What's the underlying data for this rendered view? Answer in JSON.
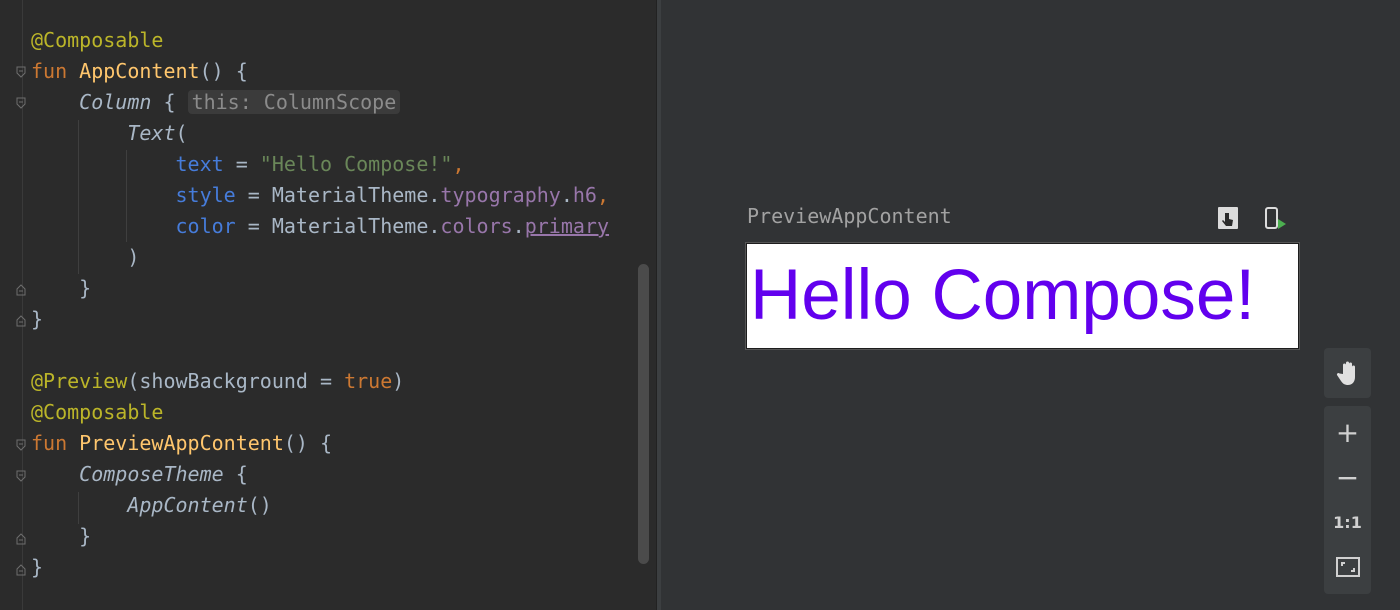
{
  "editor": {
    "lines": [
      "@Composable",
      "fun AppContent() {",
      "Column { this: ColumnScope",
      "Text(",
      "text = \"Hello Compose!\",",
      "style = MaterialTheme.typography.h6,",
      "color = MaterialTheme.colors.primary",
      ")",
      "}",
      "}",
      "",
      "@Preview(showBackground = true)",
      "@Composable",
      "fun PreviewAppContent() {",
      "ComposeTheme {",
      "AppContent()",
      "}",
      "}"
    ],
    "tokens": {
      "annotation_composable": "@Composable",
      "annotation_preview": "@Preview",
      "kw_fun": "fun",
      "fn_app_content": "AppContent",
      "parens_brace": "() {",
      "column": "Column",
      "brace_open": " {",
      "hint_column_scope": "this: ColumnScope",
      "text_call": "Text",
      "paren_open": "(",
      "param_text": "text",
      "param_style": "style",
      "param_color": "color",
      "eq": " = ",
      "string_hello": "\"Hello Compose!\"",
      "comma": ",",
      "material_theme_dot": "MaterialTheme.",
      "typography": "typography",
      "dot": ".",
      "h6": "h6",
      "colors": "colors",
      "primary": "primary",
      "paren_close": ")",
      "brace_close": "}",
      "preview_args_open": "(showBackground = ",
      "kw_true": "true",
      "fn_preview_app_content": "PreviewAppContent",
      "compose_theme": "ComposeTheme",
      "app_content_call": "AppContent",
      "parens": "()"
    }
  },
  "preview": {
    "title": "PreviewAppContent",
    "rendered_text": "Hello Compose!",
    "text_color": "#6200ee",
    "toolbar_icons": [
      "interactive-mode-icon",
      "deploy-to-device-icon"
    ],
    "tools": {
      "pan": "pan-hand-icon",
      "zoom_in": "+",
      "zoom_out": "−",
      "actual_size": "1:1",
      "fit_screen": "fit-screen-icon"
    }
  },
  "colors": {
    "background": "#2b2b2b",
    "preview_background": "#313335",
    "annotation": "#bbb529",
    "keyword": "#cc7832",
    "function": "#ffc66d",
    "parameter": "#467cda",
    "string": "#6a8759",
    "property": "#9876aa"
  }
}
